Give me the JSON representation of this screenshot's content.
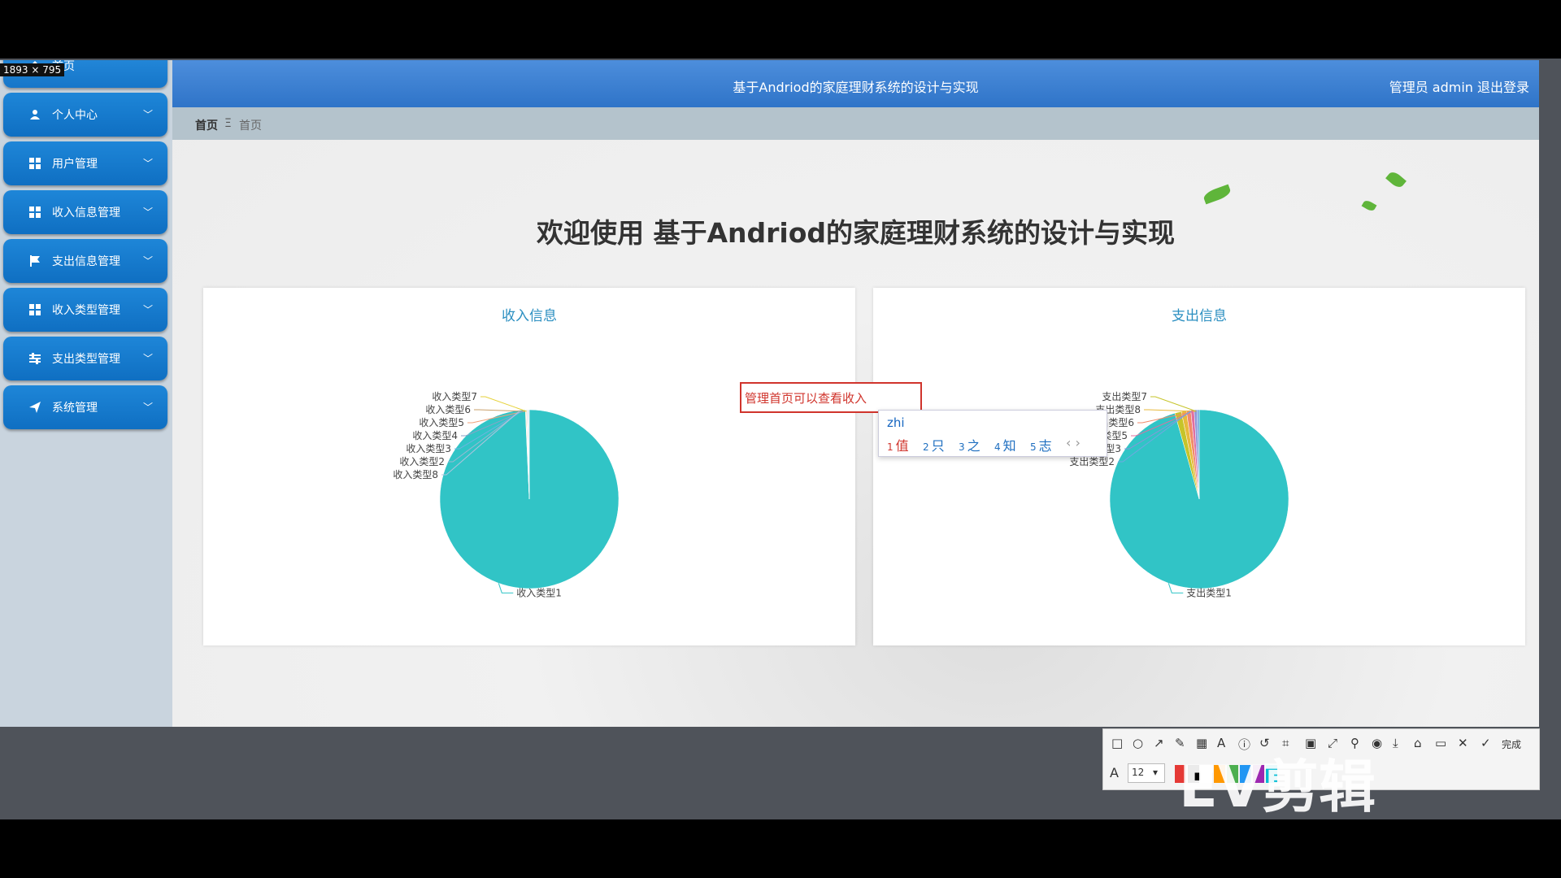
{
  "size_label": "1893 × 795",
  "app": {
    "header_title": "基于Andriod的家庭理财系统的设计与实现",
    "user_text": "管理员 admin  退出登录"
  },
  "sidebar": {
    "items": [
      {
        "label": "首页",
        "icon": "home-icon"
      },
      {
        "label": "个人中心",
        "icon": "user-icon"
      },
      {
        "label": "用户管理",
        "icon": "grid-icon"
      },
      {
        "label": "收入信息管理",
        "icon": "grid-icon"
      },
      {
        "label": "支出信息管理",
        "icon": "flag-icon"
      },
      {
        "label": "收入类型管理",
        "icon": "grid-icon"
      },
      {
        "label": "支出类型管理",
        "icon": "sliders-icon"
      },
      {
        "label": "系统管理",
        "icon": "send-icon"
      }
    ]
  },
  "breadcrumb": {
    "root": "首页",
    "current": "首页"
  },
  "welcome": "欢迎使用 基于Andriod的家庭理财系统的设计与实现",
  "chart_data": [
    {
      "type": "pie",
      "title": "收入信息",
      "labels": [
        "收入类型1",
        "收入类型7",
        "收入类型6",
        "收入类型5",
        "收入类型4",
        "收入类型3",
        "收入类型2",
        "收入类型8"
      ],
      "values": [
        99.3,
        0.1,
        0.1,
        0.1,
        0.1,
        0.1,
        0.1,
        0.1
      ],
      "colors": [
        "#31c4c6",
        "#e6d23a",
        "#c9a06b",
        "#f0a07a",
        "#8aa2c7",
        "#6fb3e0",
        "#9bb8d2",
        "#b0c4de"
      ]
    },
    {
      "type": "pie",
      "title": "支出信息",
      "labels": [
        "支出类型1",
        "支出类型7",
        "支出类型8",
        "支出类型6",
        "支出类型5",
        "支出类型3",
        "支出类型2"
      ],
      "values": [
        95.6,
        1.2,
        0.9,
        0.8,
        0.6,
        0.5,
        0.4
      ],
      "colors": [
        "#31c4c6",
        "#c6c42a",
        "#e8b93c",
        "#f08a6a",
        "#e06fa0",
        "#8b94d8",
        "#70a8e0"
      ]
    }
  ],
  "ime": {
    "input_text": "管理首页可以查看收入",
    "pinyin": "zhi",
    "candidates": [
      {
        "n": "1",
        "c": "值"
      },
      {
        "n": "2",
        "c": "只"
      },
      {
        "n": "3",
        "c": "之"
      },
      {
        "n": "4",
        "c": "知"
      },
      {
        "n": "5",
        "c": "志"
      }
    ]
  },
  "toolbar": {
    "done": "完成",
    "font_size": "12",
    "colors": [
      "#e53935",
      "#000000",
      "#ffffff",
      "#ff9800",
      "#4caf50",
      "#2196f3",
      "#9c27b0",
      "#00bcd4"
    ]
  },
  "watermark": "EV剪辑"
}
